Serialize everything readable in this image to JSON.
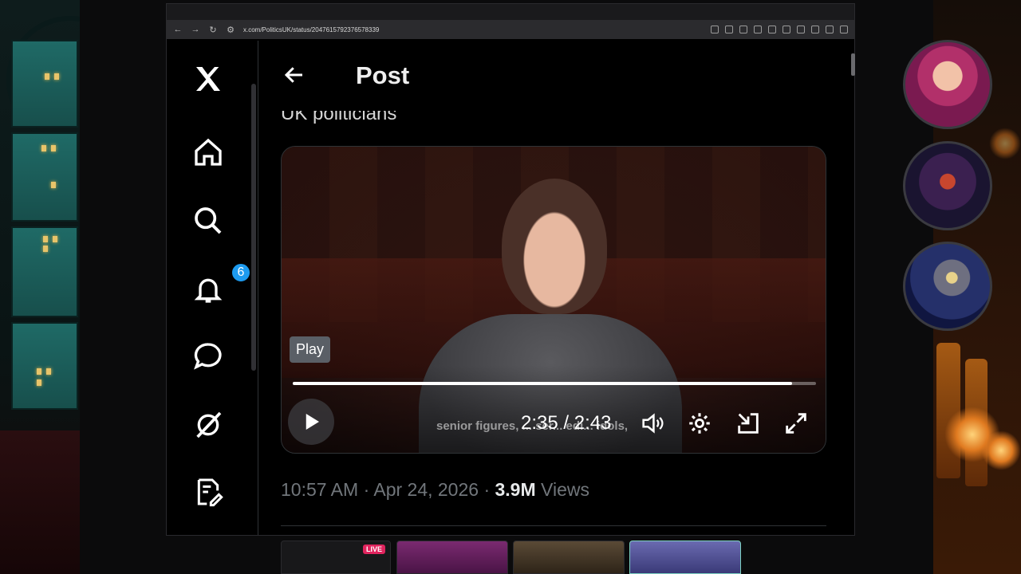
{
  "browser": {
    "url": "x.com/PoliticsUK/status/2047615792376578339"
  },
  "sidebar": {
    "items": [
      {
        "name": "x-logo-icon"
      },
      {
        "name": "home-icon"
      },
      {
        "name": "search-icon"
      },
      {
        "name": "notifications-icon",
        "badge": "6"
      },
      {
        "name": "messages-icon"
      },
      {
        "name": "grok-icon"
      },
      {
        "name": "compose-icon"
      }
    ]
  },
  "header": {
    "title": "Post"
  },
  "post": {
    "text_snippet": "UK politicians",
    "timestamp": "10:57 AM · Apr 24, 2026 · ",
    "views_count": "3.9M",
    "views_label": " Views"
  },
  "video": {
    "tooltip": "Play",
    "caption": "senior figures, ... ser... edi... idols,",
    "time": "2:35 / 2:43",
    "progress": 0.954
  },
  "thumbnails": {
    "live_label": "LIVE"
  },
  "colors": {
    "accent": "#1d9bf0",
    "live": "#e0245e",
    "background": "#000000"
  }
}
